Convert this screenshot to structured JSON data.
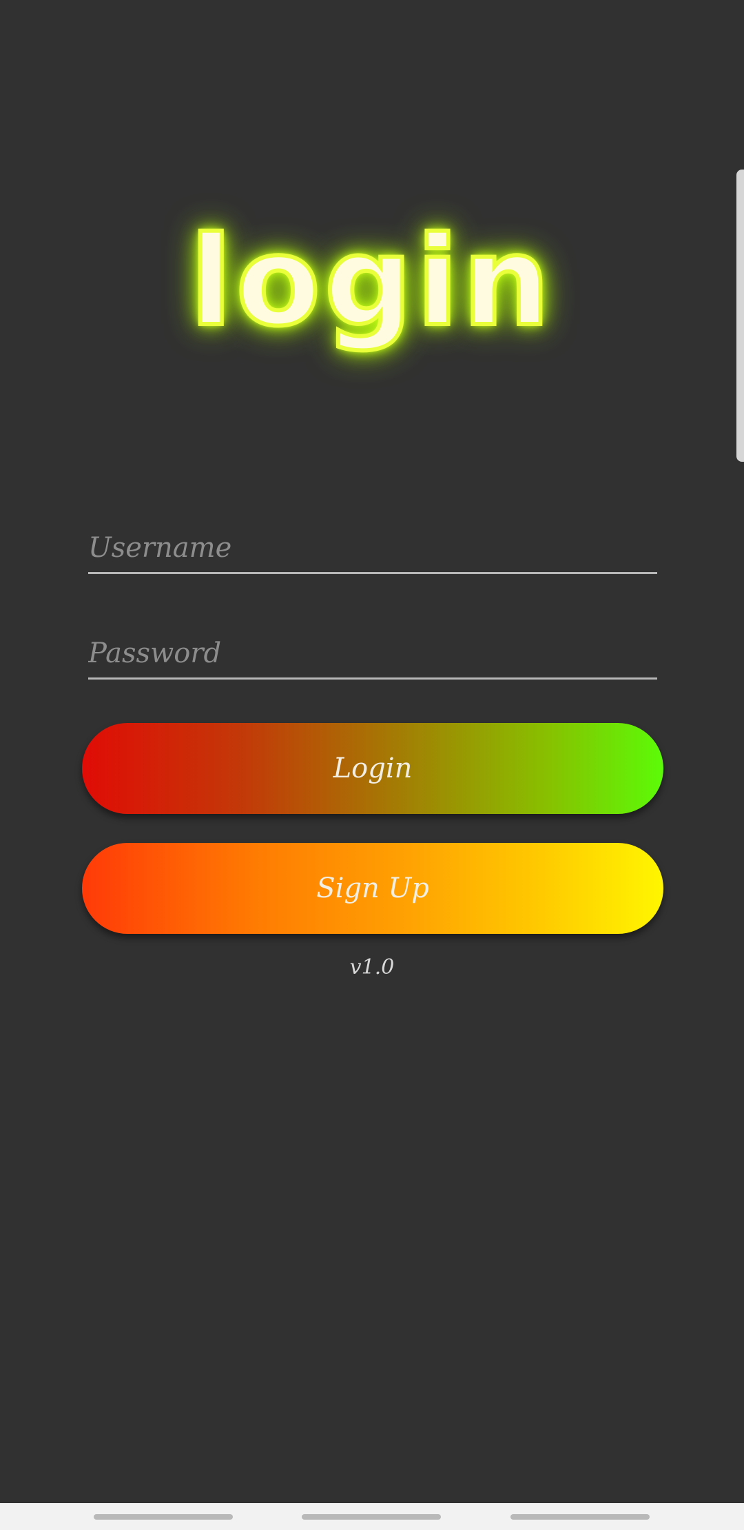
{
  "app": {
    "logo_text": "login",
    "version": "v1.0"
  },
  "form": {
    "username": {
      "placeholder": "Username",
      "value": ""
    },
    "password": {
      "placeholder": "Password",
      "value": ""
    }
  },
  "buttons": {
    "login_label": "Login",
    "signup_label": "Sign Up"
  },
  "colors": {
    "background": "#313131",
    "logo_glow": "#c8ff1a",
    "login_gradient": [
      "#e00c06",
      "#5cfb08"
    ],
    "signup_gradient": [
      "#ff3a08",
      "#fff600"
    ]
  },
  "system_nav": {
    "items": [
      "recent-apps",
      "home",
      "back"
    ]
  }
}
